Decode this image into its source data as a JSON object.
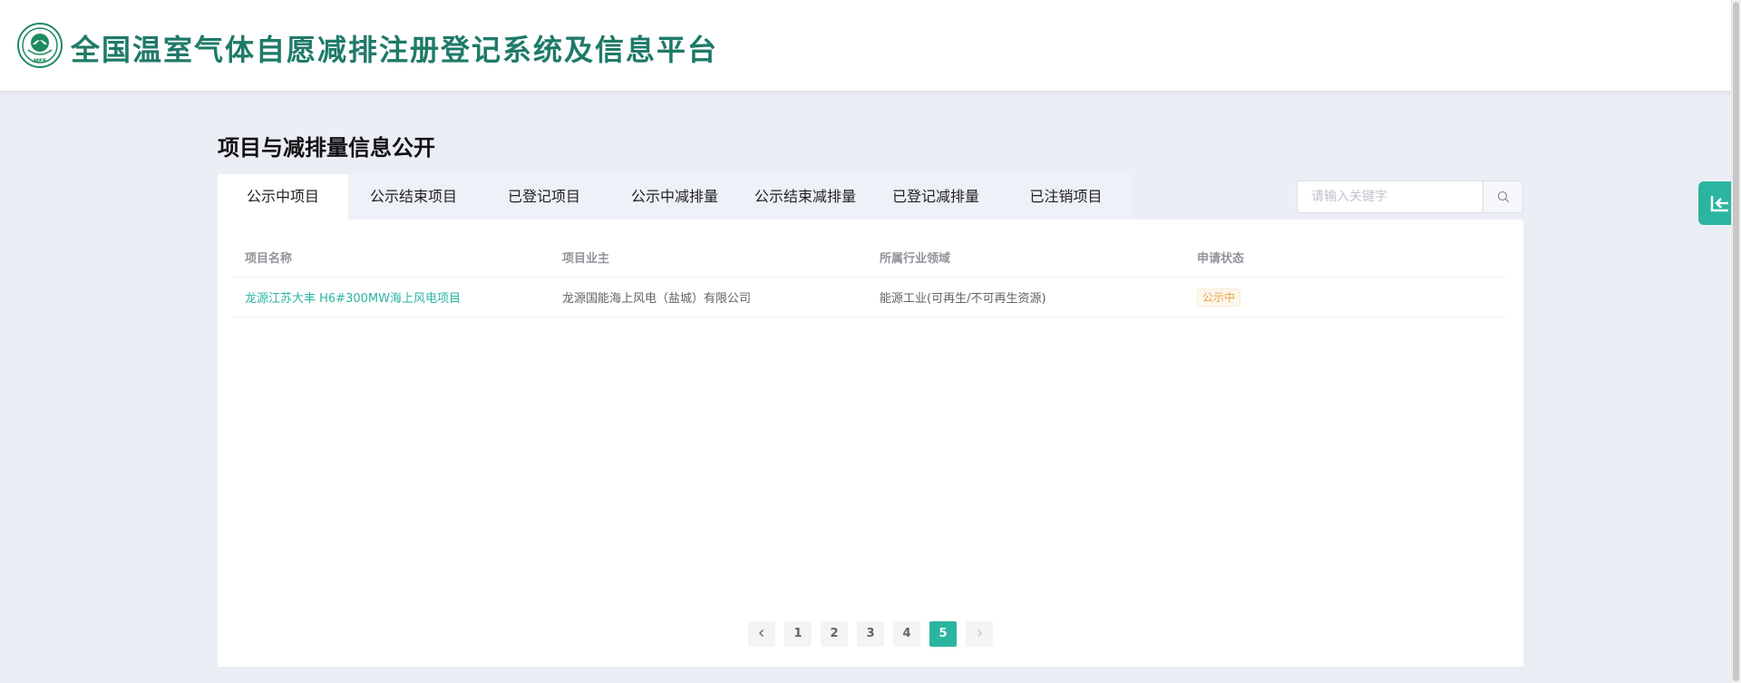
{
  "header": {
    "site_title": "全国温室气体自愿减排注册登记系统及信息平台",
    "logo_text": "MEE",
    "brand_color": "#1f7a68"
  },
  "page": {
    "title": "项目与减排量信息公开"
  },
  "tabs": [
    {
      "label": "公示中项目",
      "active": true
    },
    {
      "label": "公示结束项目",
      "active": false
    },
    {
      "label": "已登记项目",
      "active": false
    },
    {
      "label": "公示中减排量",
      "active": false
    },
    {
      "label": "公示结束减排量",
      "active": false
    },
    {
      "label": "已登记减排量",
      "active": false
    },
    {
      "label": "已注销项目",
      "active": false
    }
  ],
  "search": {
    "placeholder": "请输入关键字",
    "value": "",
    "icon": "search-icon"
  },
  "table": {
    "columns": [
      "项目名称",
      "项目业主",
      "所属行业领域",
      "申请状态"
    ],
    "rows": [
      {
        "name": "龙源江苏大丰 H6#300MW海上风电项目",
        "owner": "龙源国能海上风电（盐城）有限公司",
        "industry": "能源工业(可再生/不可再生资源)",
        "status": "公示中"
      }
    ]
  },
  "pagination": {
    "prev_icon": "chevron-left-icon",
    "next_icon": "chevron-right-icon",
    "pages": [
      "1",
      "2",
      "3",
      "4",
      "5"
    ],
    "current": "5"
  },
  "float_button": {
    "icon": "return-icon"
  },
  "colors": {
    "accent": "#2bb5a0",
    "status_warning": "#e6a23c",
    "background": "#eceef5"
  }
}
